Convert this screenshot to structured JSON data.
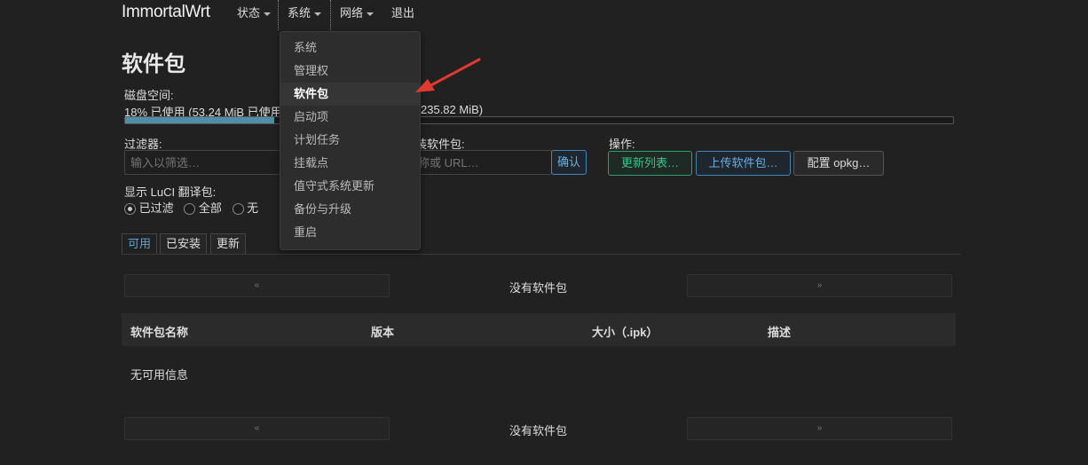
{
  "brand": "ImmortalWrt",
  "nav": {
    "items": [
      {
        "label": "状态"
      },
      {
        "label": "系统"
      },
      {
        "label": "网络"
      },
      {
        "label": "退出"
      }
    ]
  },
  "dropdown": {
    "items": [
      {
        "label": "系统"
      },
      {
        "label": "管理权"
      },
      {
        "label": "软件包"
      },
      {
        "label": "启动项"
      },
      {
        "label": "计划任务"
      },
      {
        "label": "挂载点"
      },
      {
        "label": "值守式系统更新"
      },
      {
        "label": "备份与升级"
      },
      {
        "label": "重启"
      }
    ],
    "active_index": 2
  },
  "page_title": "软件包",
  "disk": {
    "label": "磁盘空间:",
    "usage_text_left": "18% 已使用 (53.24 MiB 已使用",
    "usage_text_right": "235.82 MiB)",
    "used_fraction": 0.18
  },
  "filter": {
    "label": "过滤器:",
    "placeholder": "输入以筛选…"
  },
  "install": {
    "label_fragment": "装软件包:",
    "placeholder_fragment": "称或 URL…",
    "confirm_label": "确认"
  },
  "actions": {
    "label": "操作:",
    "update_lists": "更新列表…",
    "upload_package": "上传软件包…",
    "configure_opkg": "配置 opkg…"
  },
  "translations": {
    "label": "显示 LuCI 翻译包:",
    "options": [
      {
        "label": "已过滤",
        "checked": true
      },
      {
        "label": "全部",
        "checked": false
      },
      {
        "label": "无",
        "checked": false
      }
    ]
  },
  "tabs": [
    {
      "label": "可用",
      "active": true
    },
    {
      "label": "已安装",
      "active": false
    },
    {
      "label": "更新",
      "active": false
    }
  ],
  "pager": {
    "prev": "«",
    "next": "»",
    "status": "没有软件包"
  },
  "table": {
    "headers": [
      "软件包名称",
      "版本",
      "大小（.ipk）",
      "描述"
    ],
    "empty_text": "无可用信息"
  },
  "colors": {
    "background": "#212121",
    "progress_fill": "#4e8fa3",
    "annotation_arrow": "#e03a2f"
  }
}
